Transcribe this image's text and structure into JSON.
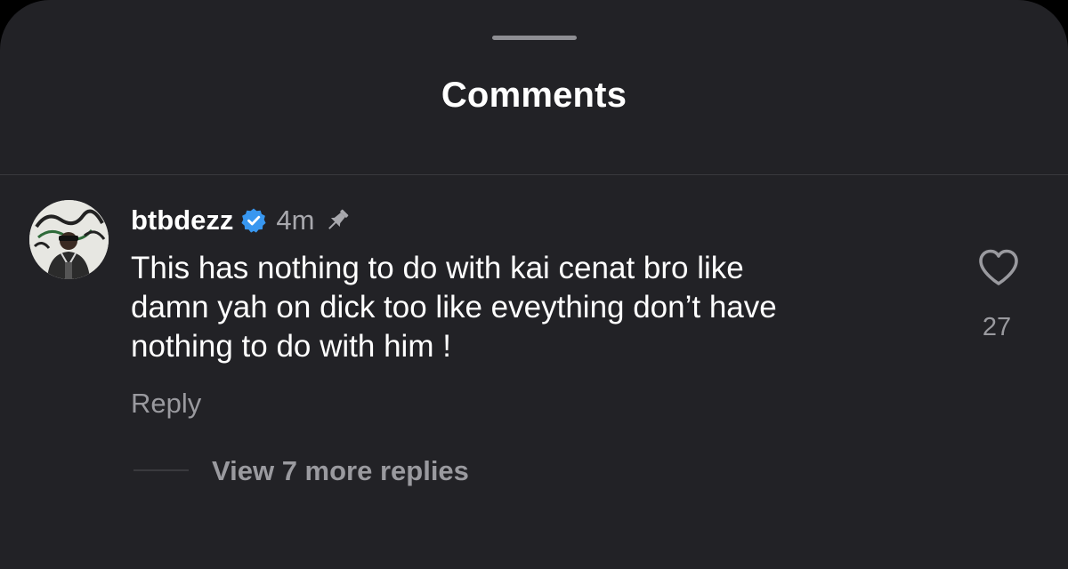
{
  "sheet": {
    "title": "Comments"
  },
  "comment": {
    "username": "btbdezz",
    "verified_icon": "verified-badge-icon",
    "time_ago": "4m",
    "pinned_icon": "pin-icon",
    "lines": [
      "This has nothing to do with kai cenat bro like",
      "damn yah on dick too like eveything don’t have",
      "nothing to do with him !"
    ],
    "reply_label": "Reply",
    "like_icon": "heart-outline-icon",
    "like_count": "27",
    "view_replies_label": "View 7 more replies"
  },
  "colors": {
    "sheet_background": "#222226",
    "primary_text": "#ffffff",
    "secondary_text": "#9a9a9f",
    "verified_blue": "#3897f0"
  }
}
